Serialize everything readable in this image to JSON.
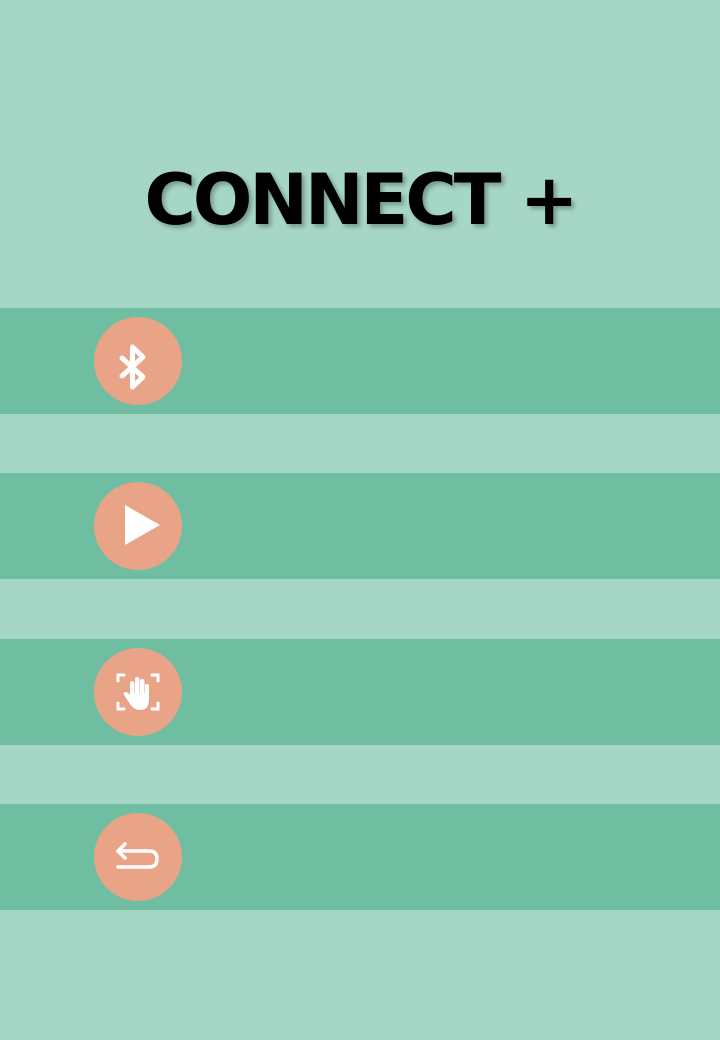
{
  "header": {
    "title": "CONNECT +"
  },
  "menu": {
    "items": [
      {
        "icon": "bluetooth-icon",
        "action": "bluetooth"
      },
      {
        "icon": "play-icon",
        "action": "play"
      },
      {
        "icon": "hand-scan-icon",
        "action": "gesture-scan"
      },
      {
        "icon": "back-arrow-icon",
        "action": "back"
      }
    ]
  },
  "colors": {
    "background": "#a6d6c6",
    "band": "#70bea2",
    "button": "#e9a386",
    "icon": "#ffffff",
    "title": "#000000"
  }
}
